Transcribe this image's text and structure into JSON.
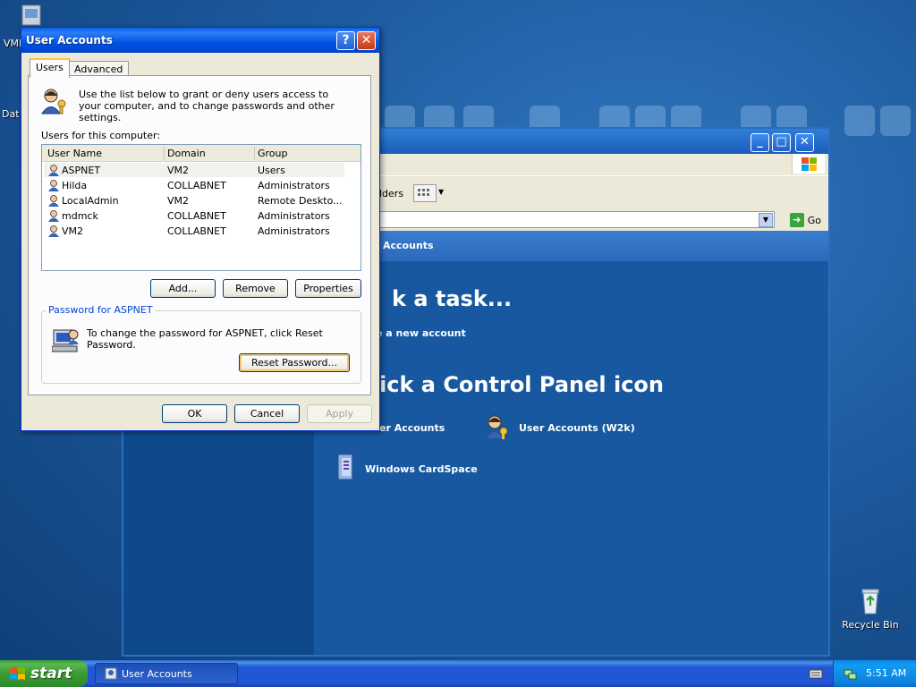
{
  "desktop": {
    "icons": [
      {
        "label": "VMM"
      },
      {
        "label": "Dat"
      },
      {
        "label": "Recycle Bin"
      }
    ]
  },
  "control_panel": {
    "header": "Accounts",
    "toolbar_fragment": "lders",
    "address_go": "Go",
    "pick_task": "k a task...",
    "create_account": "e a new account",
    "pick_icon": "ick a Control Panel icon",
    "items": [
      {
        "label": "er Accounts"
      },
      {
        "label": "User Accounts (W2k)"
      },
      {
        "label": "Windows CardSpace"
      }
    ]
  },
  "dialog": {
    "title": "User Accounts",
    "tabs": [
      {
        "label": "Users",
        "active": true
      },
      {
        "label": "Advanced",
        "active": false
      }
    ],
    "intro": "Use the list below to grant or deny users access to your computer, and to change passwords and other settings.",
    "users_label": "Users for this computer:",
    "columns": [
      "User Name",
      "Domain",
      "Group"
    ],
    "users": [
      {
        "name": "ASPNET",
        "domain": "VM2",
        "group": "Users",
        "selected": true
      },
      {
        "name": "Hilda",
        "domain": "COLLABNET",
        "group": "Administrators",
        "selected": false
      },
      {
        "name": "LocalAdmin",
        "domain": "VM2",
        "group": "Remote Deskto...",
        "selected": false
      },
      {
        "name": "mdmck",
        "domain": "COLLABNET",
        "group": "Administrators",
        "selected": false
      },
      {
        "name": "VM2",
        "domain": "COLLABNET",
        "group": "Administrators",
        "selected": false
      }
    ],
    "buttons": {
      "add": "Add...",
      "remove": "Remove",
      "properties": "Properties"
    },
    "password_group": {
      "legend": "Password for ASPNET",
      "text": "To change the password for ASPNET, click Reset Password.",
      "reset": "Reset Password..."
    },
    "footer": {
      "ok": "OK",
      "cancel": "Cancel",
      "apply": "Apply"
    }
  },
  "taskbar": {
    "start": "start",
    "task_label": "User Accounts",
    "clock": "5:51 AM"
  },
  "colors": {
    "title_blue": "#0054e3",
    "desktop_blue": "#1d5a9e",
    "start_green": "#3b9b34"
  }
}
